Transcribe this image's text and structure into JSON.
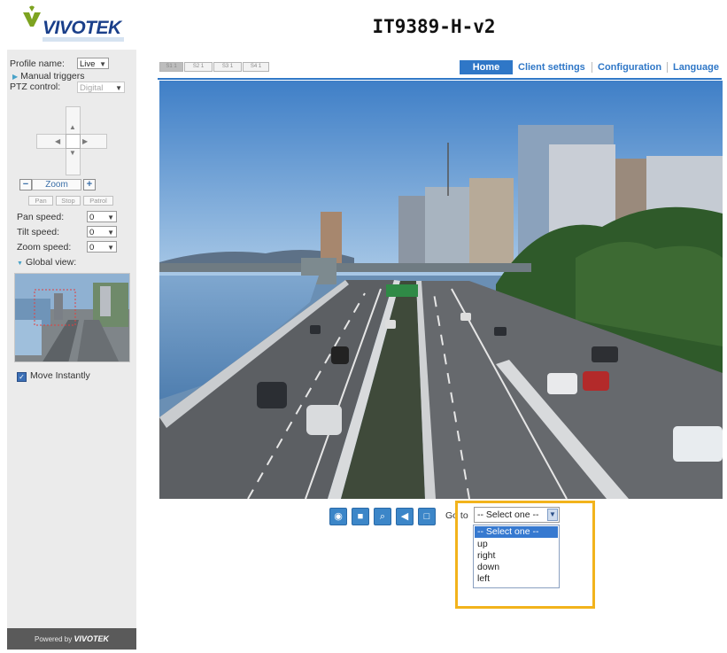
{
  "app": {
    "brand": "VIVOTEK",
    "title": "IT9389-H-v2"
  },
  "sidebar": {
    "profile_label": "Profile name:",
    "profile_value": "Live",
    "manual_triggers": "Manual triggers",
    "ptz_label": "PTZ control:",
    "ptz_value": "Digital",
    "zoom_minus": "−",
    "zoom_label": "Zoom",
    "zoom_plus": "+",
    "pan_btn": "Pan",
    "stop_btn": "Stop",
    "patrol_btn": "Patrol",
    "pan_speed_label": "Pan speed:",
    "pan_speed_value": "0",
    "tilt_speed_label": "Tilt speed:",
    "tilt_speed_value": "0",
    "zoom_speed_label": "Zoom speed:",
    "zoom_speed_value": "0",
    "global_view": "Global view:",
    "move_instantly": "Move Instantly",
    "move_instantly_checked": true,
    "powered_by": "Powered by",
    "powered_brand": "VIVOTEK"
  },
  "streams": [
    {
      "label": "S1 1",
      "active": true
    },
    {
      "label": "S2 1",
      "active": false
    },
    {
      "label": "S3 1",
      "active": false
    },
    {
      "label": "S4 1",
      "active": false
    }
  ],
  "nav": {
    "home": "Home",
    "client_settings": "Client settings",
    "configuration": "Configuration",
    "language": "Language"
  },
  "toolbar": {
    "icons": [
      "camera-snapshot-icon",
      "record-icon",
      "digital-zoom-icon",
      "audio-icon",
      "fullscreen-icon"
    ]
  },
  "goto": {
    "label": "Go to",
    "selected": "-- Select one --",
    "options": [
      "-- Select one --",
      "up",
      "right",
      "down",
      "left"
    ]
  },
  "colors": {
    "accent_blue": "#2f77c7",
    "highlight_border": "#f2b31c",
    "sidebar_bg": "#ebebeb"
  }
}
